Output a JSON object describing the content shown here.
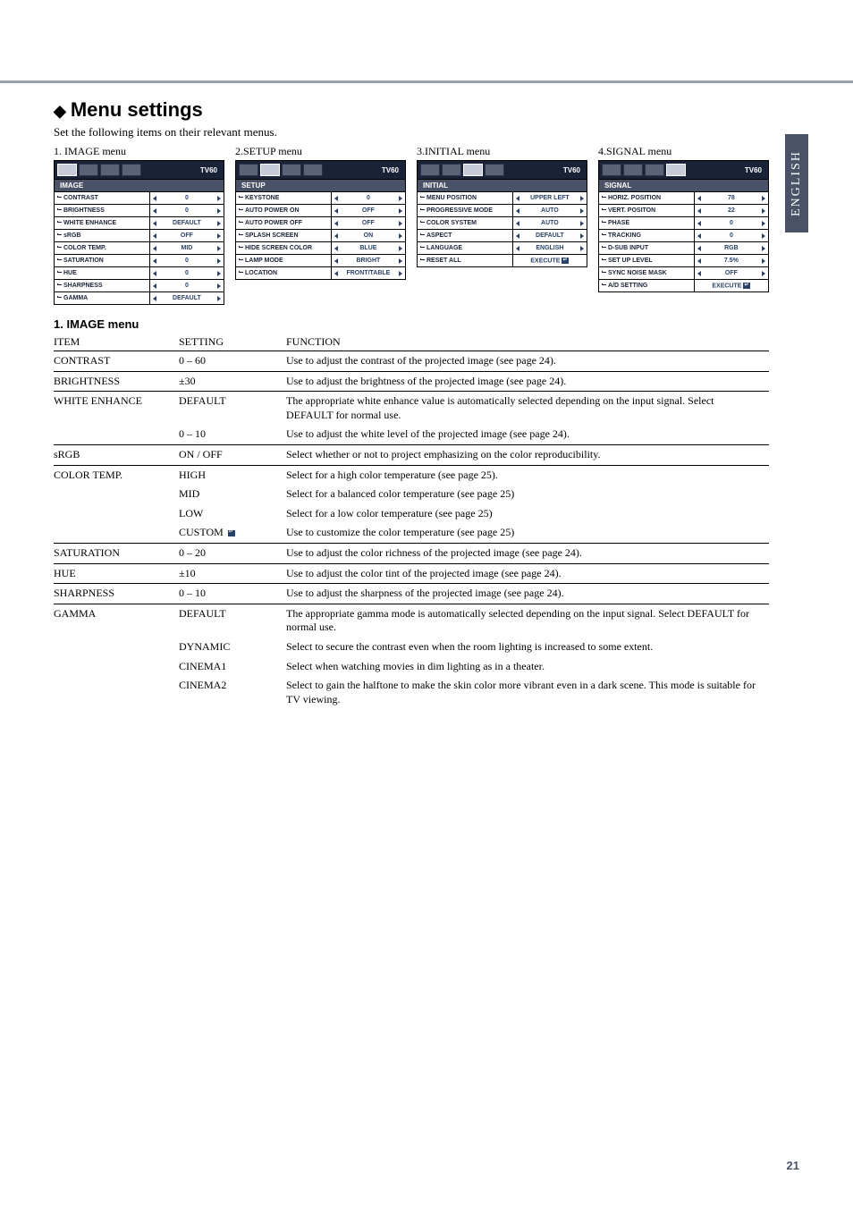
{
  "page": {
    "title": "Menu settings",
    "subtitle": "Set the following items on their relevant menus.",
    "side_tab": "ENGLISH",
    "page_number": "21"
  },
  "menus": [
    {
      "caption": "1. IMAGE menu",
      "model": "TV60",
      "section": "IMAGE",
      "items": [
        {
          "label": "CONTRAST",
          "value": "0",
          "arrows": true
        },
        {
          "label": "BRIGHTNESS",
          "value": "0",
          "arrows": true
        },
        {
          "label": "WHITE ENHANCE",
          "value": "DEFAULT",
          "arrows": true
        },
        {
          "label": "sRGB",
          "value": "OFF",
          "arrows": true
        },
        {
          "label": "COLOR TEMP.",
          "value": "MID",
          "arrows": true
        },
        {
          "label": "SATURATION",
          "value": "0",
          "arrows": true
        },
        {
          "label": "HUE",
          "value": "0",
          "arrows": true
        },
        {
          "label": "SHARPNESS",
          "value": "0",
          "arrows": true
        },
        {
          "label": "GAMMA",
          "value": "DEFAULT",
          "arrows": true
        }
      ]
    },
    {
      "caption": "2.SETUP menu",
      "model": "TV60",
      "section": "SETUP",
      "items": [
        {
          "label": "KEYSTONE",
          "value": "0",
          "arrows": true
        },
        {
          "label": "AUTO POWER ON",
          "value": "OFF",
          "arrows": true
        },
        {
          "label": "AUTO POWER OFF",
          "value": "OFF",
          "arrows": true
        },
        {
          "label": "SPLASH SCREEN",
          "value": "ON",
          "arrows": true
        },
        {
          "label": "HIDE SCREEN COLOR",
          "value": "BLUE",
          "arrows": true
        },
        {
          "label": "LAMP MODE",
          "value": "BRIGHT",
          "arrows": true
        },
        {
          "label": "LOCATION",
          "value": "FRONT/TABLE",
          "arrows": true
        }
      ]
    },
    {
      "caption": "3.INITIAL menu",
      "model": "TV60",
      "section": "INITIAL",
      "items": [
        {
          "label": "MENU POSITION",
          "value": "UPPER LEFT",
          "arrows": true
        },
        {
          "label": "PROGRESSIVE MODE",
          "value": "AUTO",
          "arrows": true
        },
        {
          "label": "COLOR SYSTEM",
          "value": "AUTO",
          "arrows": true
        },
        {
          "label": "ASPECT",
          "value": "DEFAULT",
          "arrows": true
        },
        {
          "label": "LANGUAGE",
          "value": "ENGLISH",
          "arrows": true
        },
        {
          "label": "RESET ALL",
          "value": "EXECUTE",
          "arrows": false,
          "enter": true
        }
      ]
    },
    {
      "caption": "4.SIGNAL menu",
      "model": "TV60",
      "section": "SIGNAL",
      "items": [
        {
          "label": "HORIZ. POSITION",
          "value": "78",
          "arrows": true
        },
        {
          "label": "VERT. POSITON",
          "value": "22",
          "arrows": true
        },
        {
          "label": "PHASE",
          "value": "0",
          "arrows": true
        },
        {
          "label": "TRACKING",
          "value": "0",
          "arrows": true
        },
        {
          "label": "D-SUB INPUT",
          "value": "RGB",
          "arrows": true
        },
        {
          "label": "SET UP LEVEL",
          "value": "7.5%",
          "arrows": true
        },
        {
          "label": "SYNC NOISE MASK",
          "value": "OFF",
          "arrows": true
        },
        {
          "label": "A/D SETTING",
          "value": "EXECUTE",
          "arrows": false,
          "enter": true
        }
      ]
    }
  ],
  "table": {
    "section_title": "1.  IMAGE menu",
    "headers": {
      "item": "ITEM",
      "setting": "SETTING",
      "function": "FUNCTION"
    },
    "rows": [
      {
        "item": "CONTRAST",
        "setting": "0 – 60",
        "function": "Use to adjust the contrast of the projected image (see page 24).",
        "sep": true
      },
      {
        "item": "BRIGHTNESS",
        "setting": "±30",
        "function": "Use to adjust the brightness of the projected image (see page 24).",
        "sep": true
      },
      {
        "item": "WHITE ENHANCE",
        "setting": "DEFAULT",
        "function": "The appropriate white enhance value is automatically selected depending on the input signal. Select DEFAULT for normal use.",
        "sep": true
      },
      {
        "item": "",
        "setting": "0 – 10",
        "function": "Use to adjust the white level of the projected image (see page 24)."
      },
      {
        "item": "sRGB",
        "setting": "ON / OFF",
        "function": "Select whether or not to project emphasizing on the color reproducibility.",
        "sep": true
      },
      {
        "item": "COLOR TEMP.",
        "setting": "HIGH",
        "function": "Select for a high color temperature (see page 25).",
        "sep": true
      },
      {
        "item": "",
        "setting": "MID",
        "function": "Select for a balanced color temperature (see page 25)"
      },
      {
        "item": "",
        "setting": "LOW",
        "function": "Select for a low color temperature (see page 25)"
      },
      {
        "item": "",
        "setting": "CUSTOM",
        "function": "Use to customize the color temperature (see page 25)",
        "enter": true
      },
      {
        "item": "SATURATION",
        "setting": "0 – 20",
        "function": "Use to adjust the color richness of the projected image (see page 24).",
        "sep": true
      },
      {
        "item": "HUE",
        "setting": "±10",
        "function": "Use to adjust the color tint of the projected image (see page 24).",
        "sep": true
      },
      {
        "item": "SHARPNESS",
        "setting": "0 – 10",
        "function": "Use to adjust the sharpness of the projected image (see page 24).",
        "sep": true
      },
      {
        "item": "GAMMA",
        "setting": "DEFAULT",
        "function": "The appropriate gamma mode is automatically selected depending on the input signal. Select DEFAULT for normal use.",
        "sep": true
      },
      {
        "item": "",
        "setting": "DYNAMIC",
        "function": "Select to secure the contrast even when the room lighting is increased to some extent."
      },
      {
        "item": "",
        "setting": "CINEMA1",
        "function": "Select when watching movies in dim lighting as in a theater."
      },
      {
        "item": "",
        "setting": "CINEMA2",
        "function": "Select to gain the halftone to make the skin color more vibrant even in a dark scene. This mode is suitable for TV viewing."
      }
    ]
  }
}
